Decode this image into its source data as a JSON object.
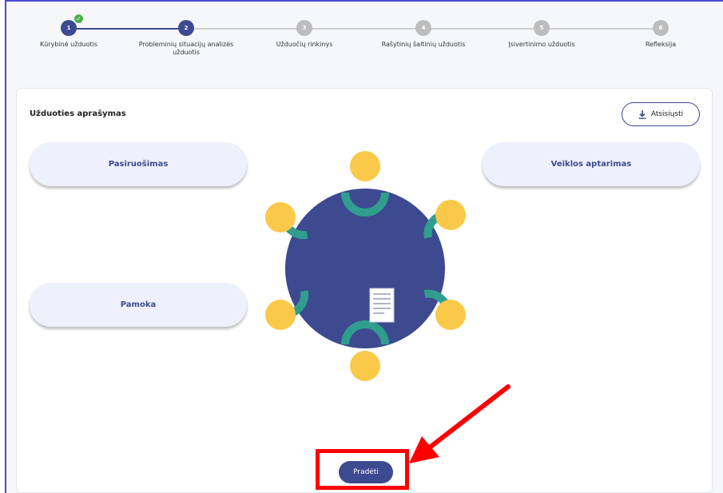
{
  "stepper": {
    "steps": [
      {
        "number": "1",
        "label": "Kūrybinė užduotis",
        "state": "done"
      },
      {
        "number": "2",
        "label": "Probleminių situacijų analizės užduotis",
        "state": "active"
      },
      {
        "number": "3",
        "label": "Užduočių rinkinys",
        "state": "pending"
      },
      {
        "number": "4",
        "label": "Rašytinių šaltinių užduotis",
        "state": "pending"
      },
      {
        "number": "5",
        "label": "Įsivertinimo užduotis",
        "state": "pending"
      },
      {
        "number": "6",
        "label": "Refleksija",
        "state": "pending"
      }
    ]
  },
  "card": {
    "title": "Užduoties aprašymas",
    "download_label": "Atsisiųsti",
    "pills": {
      "preparation": "Pasiruošimas",
      "lesson": "Pamoka",
      "review": "Veiklos aptarimas"
    },
    "start_label": "Pradėti"
  },
  "colors": {
    "primary": "#3d4a8f",
    "teal": "#2f9e8f",
    "yellow": "#fbc94a",
    "done_green": "#4cae4c",
    "highlight_red": "#ff0000"
  }
}
